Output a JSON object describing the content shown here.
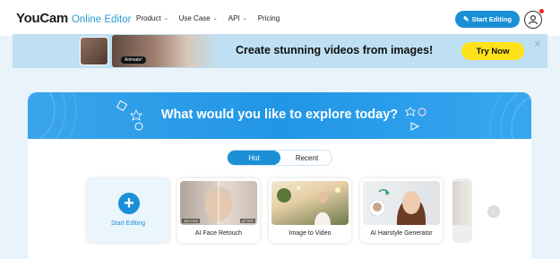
{
  "header": {
    "brand": "YouCam",
    "brand_sub": "Online Editor",
    "nav": [
      {
        "label": "Product",
        "dropdown": true
      },
      {
        "label": "Use Case",
        "dropdown": true
      },
      {
        "label": "API",
        "dropdown": true
      },
      {
        "label": "Pricing",
        "dropdown": false
      }
    ],
    "start_button": "Start Editing"
  },
  "promo": {
    "chip": "Animate!",
    "text": "Create stunning videos from images!",
    "cta": "Try Now",
    "close": "×"
  },
  "hero": {
    "title": "What would you like to explore today?"
  },
  "toggle": {
    "options": [
      "Hot",
      "Recent"
    ],
    "selected": "Hot"
  },
  "cards": [
    {
      "label": "Start Editing",
      "icon": "plus-icon"
    },
    {
      "label": "AI Face Retouch",
      "before": "BEFORE",
      "after": "AFTER"
    },
    {
      "label": "Image to Video"
    },
    {
      "label": "AI Hairstyle Generator"
    }
  ],
  "colors": {
    "accent": "#1a8fd6",
    "promo_bg": "#bfe0f2",
    "cta_yellow": "#ffe21a",
    "page_bg": "#e9f3f9"
  }
}
